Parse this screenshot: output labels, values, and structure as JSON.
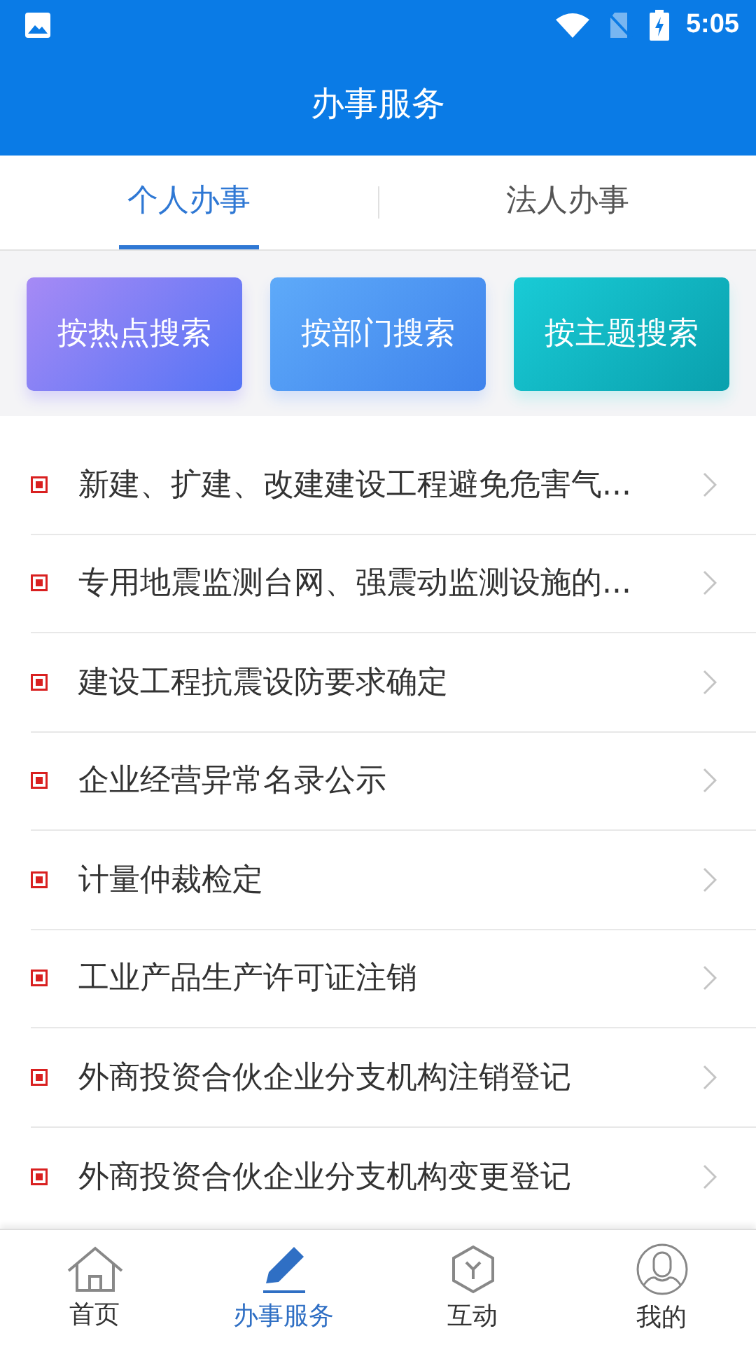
{
  "status_bar": {
    "time": "5:05"
  },
  "header": {
    "title": "办事服务"
  },
  "tabs": [
    {
      "label": "个人办事",
      "selected": true
    },
    {
      "label": "法人办事",
      "selected": false
    }
  ],
  "search_buttons": [
    {
      "label": "按热点搜索",
      "kind": "hot"
    },
    {
      "label": "按部门搜索",
      "kind": "dept"
    },
    {
      "label": "按主题搜索",
      "kind": "topic"
    }
  ],
  "items": [
    {
      "label": "新建、扩建、改建建设工程避免危害气..."
    },
    {
      "label": "专用地震监测台网、强震动监测设施的..."
    },
    {
      "label": "建设工程抗震设防要求确定"
    },
    {
      "label": "企业经营异常名录公示"
    },
    {
      "label": "计量仲裁检定"
    },
    {
      "label": "工业产品生产许可证注销"
    },
    {
      "label": "外商投资合伙企业分支机构注销登记"
    },
    {
      "label": "外商投资合伙企业分支机构变更登记"
    }
  ],
  "bottom_nav": [
    {
      "label": "首页",
      "kind": "home",
      "selected": false
    },
    {
      "label": "办事服务",
      "kind": "service",
      "selected": true
    },
    {
      "label": "互动",
      "kind": "interact",
      "selected": false
    },
    {
      "label": "我的",
      "kind": "profile",
      "selected": false
    }
  ]
}
